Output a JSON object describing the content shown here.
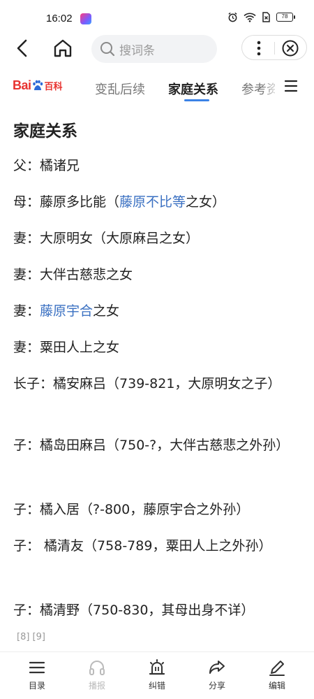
{
  "status": {
    "time": "16:02",
    "battery": "78"
  },
  "nav": {
    "search_placeholder": "搜词条"
  },
  "tabs": {
    "logo_bai": "Bai",
    "logo_du": "du",
    "logo_baike": "百科",
    "items": [
      {
        "label": "变乱后续"
      },
      {
        "label": "家庭关系"
      },
      {
        "label": "参考资料"
      }
    ]
  },
  "section": {
    "title": "家庭关系"
  },
  "relations": [
    {
      "role": "父：",
      "text": "橘诸兄"
    },
    {
      "role": "母：",
      "pre": "藤原多比能（",
      "link": "藤原不比等",
      "post": "之女）"
    },
    {
      "role": "妻：",
      "text": "大原明女（大原麻吕之女）"
    },
    {
      "role": "妻：",
      "text": "大伴古慈悲之女"
    },
    {
      "role": "妻：",
      "link": "藤原宇合",
      "post": "之女"
    },
    {
      "role": "妻：",
      "text": "粟田人上之女"
    },
    {
      "role": "长子：",
      "text": "橘安麻吕（739-821，大原明女之子）"
    },
    {
      "role": "子：",
      "text": "橘岛田麻吕（750-?，大伴古慈悲之外孙）"
    },
    {
      "role": "子：",
      "text": "橘入居（?-800，藤原宇合之外孙）"
    },
    {
      "role": "子：",
      "text": " 橘清友（758-789，粟田人上之外孙）"
    },
    {
      "role": "子：",
      "text": "橘清野（750-830，其母出身不详）"
    }
  ],
  "refs": "[8] [9]",
  "toolbar": {
    "items": [
      {
        "label": "目录",
        "icon": "list-icon"
      },
      {
        "label": "播报",
        "icon": "headphones-icon"
      },
      {
        "label": "纠错",
        "icon": "alarm-light-icon"
      },
      {
        "label": "分享",
        "icon": "share-icon"
      },
      {
        "label": "编辑",
        "icon": "pen-icon"
      }
    ]
  },
  "colors": {
    "link": "#3a70c2",
    "tab_indicator": "#3b82e6",
    "brand_red": "#e8322f"
  }
}
